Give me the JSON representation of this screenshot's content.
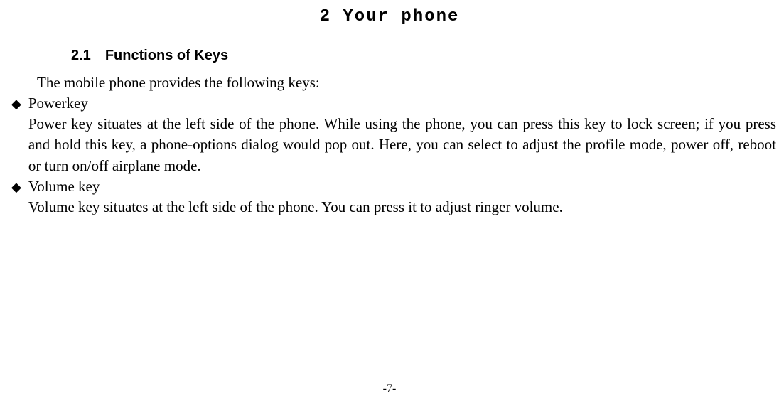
{
  "chapter": {
    "title": "2 Your phone"
  },
  "section": {
    "number": "2.1",
    "title": "Functions of Keys"
  },
  "intro": "The mobile phone provides the following keys:",
  "bullets": [
    {
      "title": "Powerkey",
      "description": "Power key situates at the left side of the phone. While using the phone, you can press this key to lock screen; if you press and hold this key, a phone-options dialog would pop out. Here, you can select to adjust the profile mode, power off, reboot or turn on/off airplane mode."
    },
    {
      "title": "Volume key",
      "description": "Volume key situates at the left side of the phone. You can press it to adjust ringer volume."
    }
  ],
  "pageNumber": "-7-",
  "bulletMarker": "◆"
}
